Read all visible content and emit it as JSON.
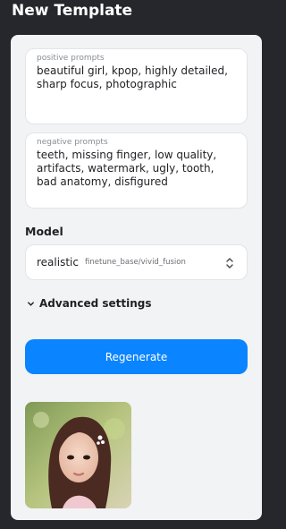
{
  "header": {
    "title": "New Template"
  },
  "positive_prompt": {
    "label": "positive prompts",
    "value": "beautiful girl, kpop, highly detailed, sharp focus, photographic"
  },
  "negative_prompt": {
    "label": "negative prompts",
    "value": "teeth, missing finger, low quality, artifacts, watermark, ugly, tooth, bad anatomy, disfigured"
  },
  "model": {
    "section_label": "Model",
    "selected_name": "realistic",
    "selected_path": "finetune_base/vivid_fusion"
  },
  "advanced": {
    "label": "Advanced settings"
  },
  "actions": {
    "regenerate_label": "Regenerate"
  },
  "colors": {
    "accent": "#0a84ff",
    "background": "#25272c",
    "panel": "#f2f3f5"
  },
  "icons": {
    "select": "chevron-up-down-icon",
    "expand": "chevron-down-icon"
  }
}
